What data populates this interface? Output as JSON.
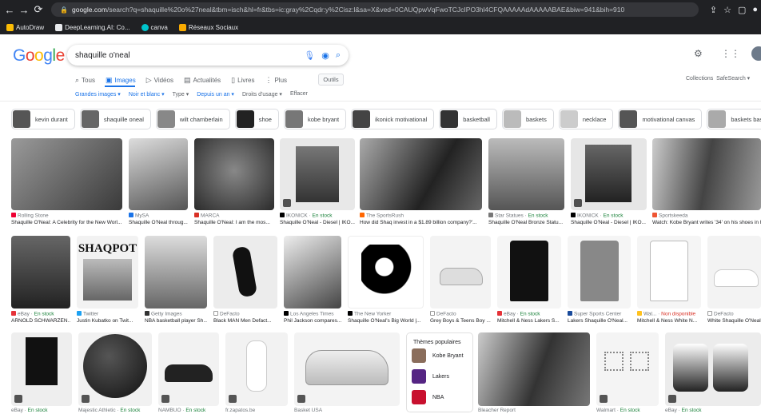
{
  "browser": {
    "url_domain": "google.com",
    "url_rest": "/search?q=shaquille%20o%27neal&tbm=isch&hl=fr&tbs=ic:gray%2Cqdr:y%2Cisz:l&sa=X&ved=0CAUQpwVqFwoTCJcIPO3hl4CFQAAAAAdAAAAABAE&biw=941&bih=910",
    "bookmarks": [
      "AutoDraw",
      "DeepLearning.AI: Co...",
      "canva",
      "Réseaux Sociaux"
    ]
  },
  "google": {
    "logo": "Google",
    "query": "shaquille o'neal"
  },
  "tabs": [
    "Tous",
    "Images",
    "Vidéos",
    "Actualités",
    "Livres",
    "Plus"
  ],
  "tools_label": "Outils",
  "collections_label": "Collections",
  "safesearch_label": "SafeSearch ▾",
  "filters": [
    "Grandes images ▾",
    "Noir et blanc ▾",
    "Type ▾",
    "Depuis un an ▾",
    "Droits d'usage ▾",
    "Effacer"
  ],
  "chips": [
    "kevin durant",
    "shaquille oneal",
    "wilt chamberlain",
    "shoe",
    "kobe bryant",
    "ikonick motivational",
    "basketball",
    "baskets",
    "necklace",
    "motivational canvas",
    "baskets basses"
  ],
  "results_row1": [
    {
      "source": "Rolling Stone",
      "title": "Shaquille O'Neal: A Celebrity for the New Worl..."
    },
    {
      "source": "MySA",
      "title": "Shaquille O'Neal throug..."
    },
    {
      "source": "MARCA",
      "title": "Shaquille O'Neal: I am the mos..."
    },
    {
      "source": "IKONICK",
      "stock": "En stock",
      "title": "Shaquille O'Neal - Diesel | IKO..."
    },
    {
      "source": "The SportsRush",
      "title": "How did Shaq invest in a $1.89 billion company?'..."
    },
    {
      "source": "Star Statues",
      "stock": "En stock",
      "title": "Shaquille O'Neal Bronze Statu..."
    },
    {
      "source": "IKONICK",
      "stock": "En stock",
      "title": "Shaquille O'Neal - Diesel | IKO..."
    },
    {
      "source": "Sportskeeda",
      "title": "Watch: Kobe Bryant writes '34' on his shoes in h..."
    }
  ],
  "results_row2": [
    {
      "source": "eBay",
      "stock": "En stock",
      "title": "ARNOLD SCHWARZEN..."
    },
    {
      "source": "Twitter",
      "title": "Justin Kubatko on Twit..."
    },
    {
      "source": "Getty Images",
      "title": "NBA basketball player Sh..."
    },
    {
      "source": "DeFacto",
      "title": "Black MAN Men Defact..."
    },
    {
      "source": "Los Angeles Times",
      "title": "Phil Jackson compares..."
    },
    {
      "source": "The New Yorker",
      "title": "Shaquille O'Neal's Big World |..."
    },
    {
      "source": "DeFacto",
      "title": "Grey Boys & Teens Boy ..."
    },
    {
      "source": "eBay",
      "stock": "En stock",
      "title": "Mitchell & Ness Lakers S..."
    },
    {
      "source": "Super Sports Center",
      "title": "Lakers Shaquille O'Neal..."
    },
    {
      "source": "Wal...",
      "nostock": "Non disponible",
      "title": "Mitchell & Ness White N..."
    },
    {
      "source": "DeFacto",
      "title": "White Shaquille O'Neal ..."
    }
  ],
  "results_row3": [
    {
      "source": "eBay",
      "stock": "En stock"
    },
    {
      "source": "Majestic Athletic",
      "stock": "En stock"
    },
    {
      "source": "NAMBUO",
      "stock": "En stock"
    },
    {
      "source": "fr.zapatos.be"
    },
    {
      "source": "Basket USA"
    },
    {
      "source": "Bleacher Report"
    },
    {
      "source": "Walmart",
      "stock": "En stock"
    },
    {
      "source": "eBay",
      "stock": "En stock"
    }
  ],
  "themes_panel": {
    "title": "Thèmes populaires",
    "items": [
      "Kobe Bryant",
      "Lakers",
      "NBA"
    ]
  },
  "colors": {
    "accent": "#1a73e8",
    "in_stock": "#188038",
    "unavailable": "#d93025"
  }
}
